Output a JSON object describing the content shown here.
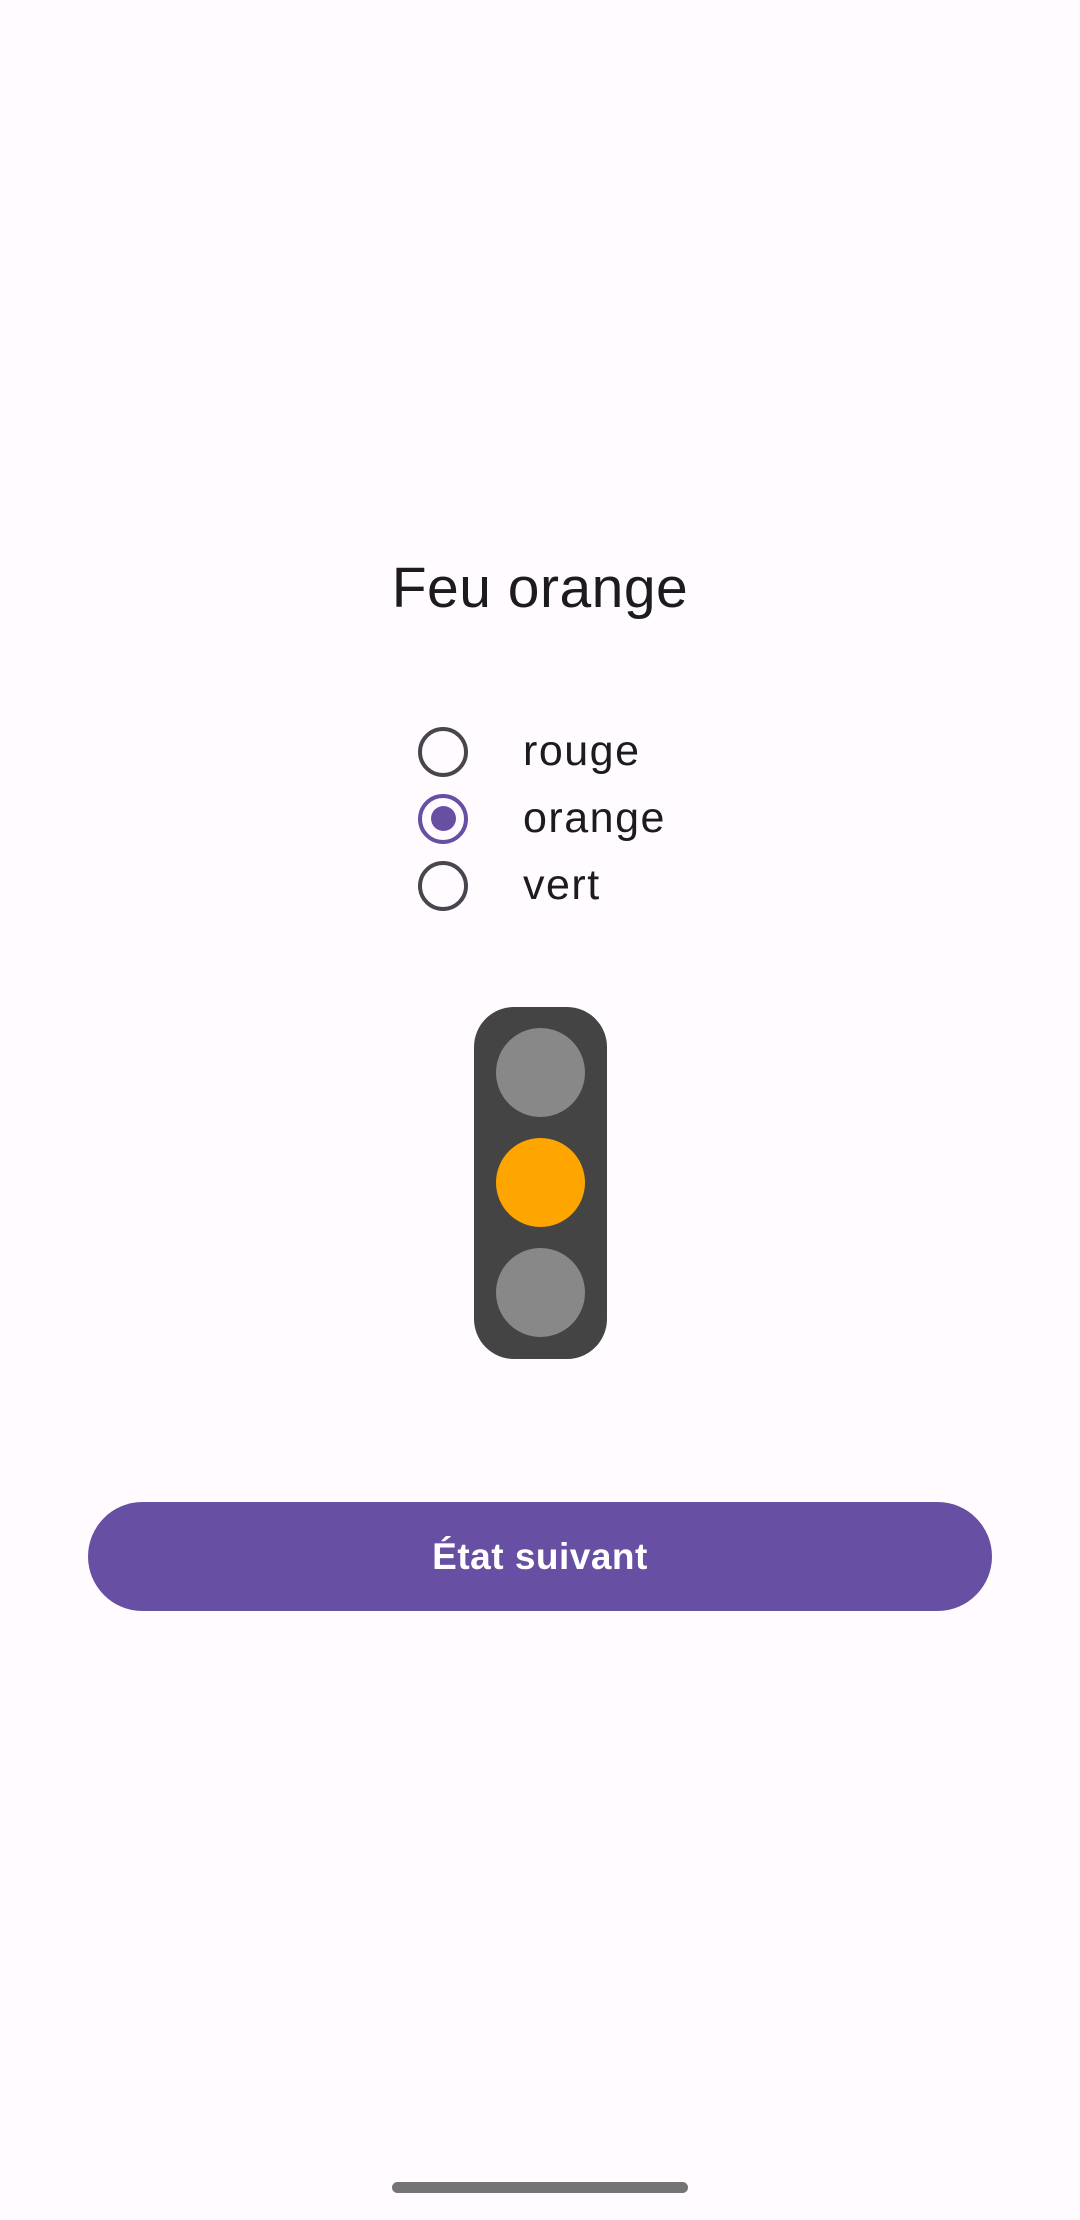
{
  "screen": {
    "title": "Feu orange",
    "background_color": "#fffbfe"
  },
  "options": [
    {
      "label": "rouge",
      "selected": false
    },
    {
      "label": "orange",
      "selected": true
    },
    {
      "label": "vert",
      "selected": false
    }
  ],
  "traffic_light": {
    "active_lamp": "orange",
    "housing_color": "#444444",
    "inactive_color": "#888888",
    "active_color": "#ffa500"
  },
  "next_button": {
    "label": "État suivant",
    "color": "#6750a4"
  },
  "accent_color": "#6750a4"
}
